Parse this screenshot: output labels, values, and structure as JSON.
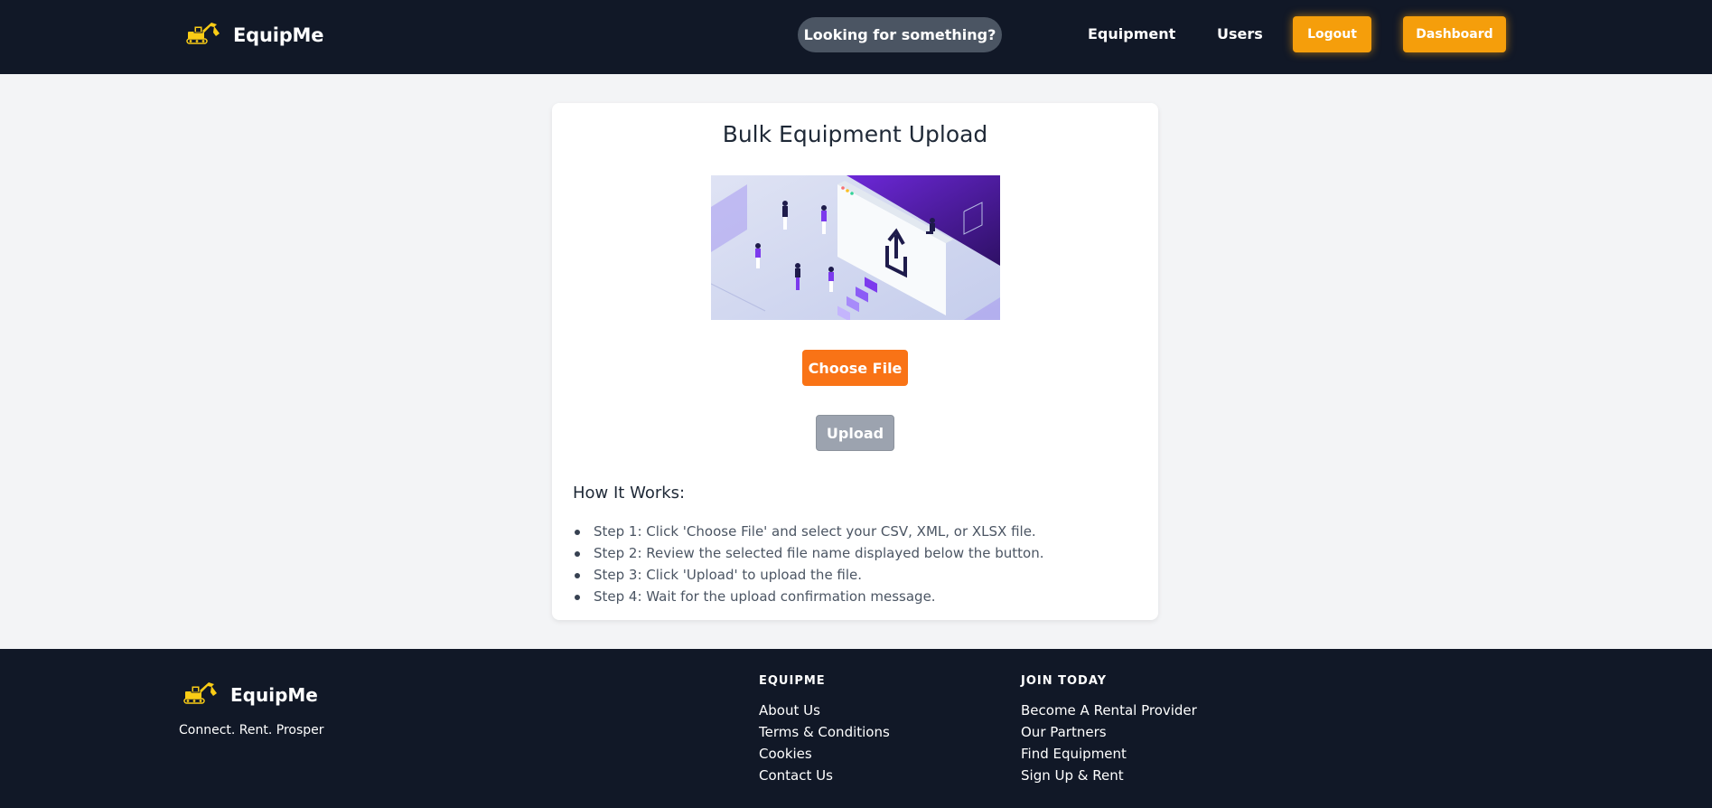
{
  "header": {
    "brand_name": "EquipMe",
    "logo_icon": "excavator-icon",
    "search_label": "Looking for something?",
    "nav": {
      "equipment": "Equipment",
      "users": "Users"
    },
    "logout_label": "Logout",
    "dashboard_label": "Dashboard"
  },
  "main": {
    "title": "Bulk Equipment Upload",
    "illustration_icon": "upload-illustration-icon",
    "choose_file_label": "Choose File",
    "upload_label": "Upload",
    "how_title": "How It Works:",
    "steps": [
      "Step 1: Click 'Choose File' and select your CSV, XML, or XLSX file.",
      "Step 2: Review the selected file name displayed below the button.",
      "Step 3: Click 'Upload' to upload the file.",
      "Step 4: Wait for the upload confirmation message."
    ]
  },
  "footer": {
    "brand_name": "EquipMe",
    "tagline": "Connect. Rent. Prosper",
    "columns": [
      {
        "heading": "EQUIPME",
        "links": [
          "About Us",
          "Terms & Conditions",
          "Cookies",
          "Contact Us"
        ]
      },
      {
        "heading": "JOIN TODAY",
        "links": [
          "Become A Rental Provider",
          "Our Partners",
          "Find Equipment",
          "Sign Up & Rent"
        ]
      }
    ]
  },
  "colors": {
    "header_bg": "#111827",
    "accent_orange": "#f59e0b",
    "choose_orange": "#f97316",
    "upload_disabled": "#9ca3af",
    "page_bg": "#f3f4f6"
  }
}
